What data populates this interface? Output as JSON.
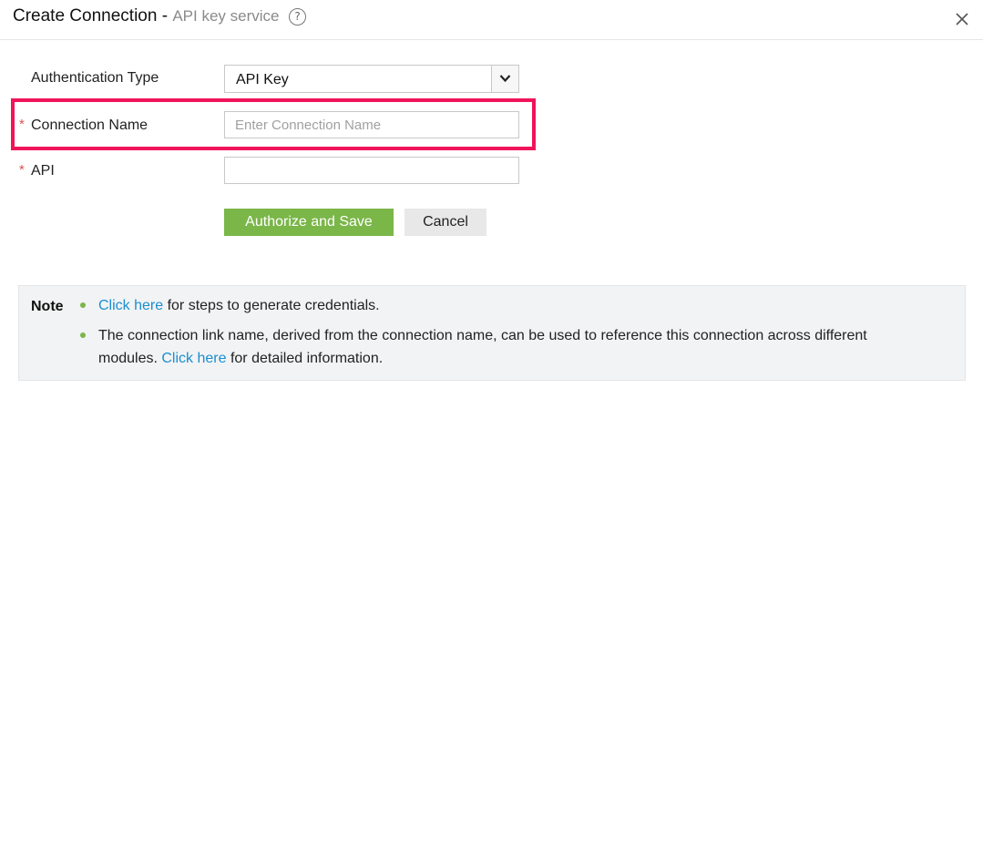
{
  "header": {
    "title": "Create Connection",
    "separator": " - ",
    "subtitle": "API key service",
    "help_glyph": "?"
  },
  "form": {
    "auth_type": {
      "label": "Authentication Type",
      "value": "API Key"
    },
    "connection_name": {
      "required_mark": "*",
      "label": "Connection Name",
      "placeholder": "Enter Connection Name",
      "value": ""
    },
    "api": {
      "required_mark": "*",
      "label": "API",
      "value": ""
    }
  },
  "buttons": {
    "authorize_save": "Authorize and Save",
    "cancel": "Cancel"
  },
  "note": {
    "title": "Note",
    "item1": {
      "link": "Click here",
      "text": " for steps to generate credentials."
    },
    "item2": {
      "text_line1": "The connection link name, derived from the connection name, can be used to reference this connection across different",
      "text_pre": "modules. ",
      "link": "Click here",
      "text_post": " for detailed information."
    }
  },
  "colors": {
    "primary": "#7ab648",
    "highlight": "#f0145a",
    "link": "#1a8fd0",
    "required": "#d9534f"
  },
  "icons": [
    "help-icon",
    "close-icon",
    "chevron-down-icon",
    "bullet-dot"
  ]
}
